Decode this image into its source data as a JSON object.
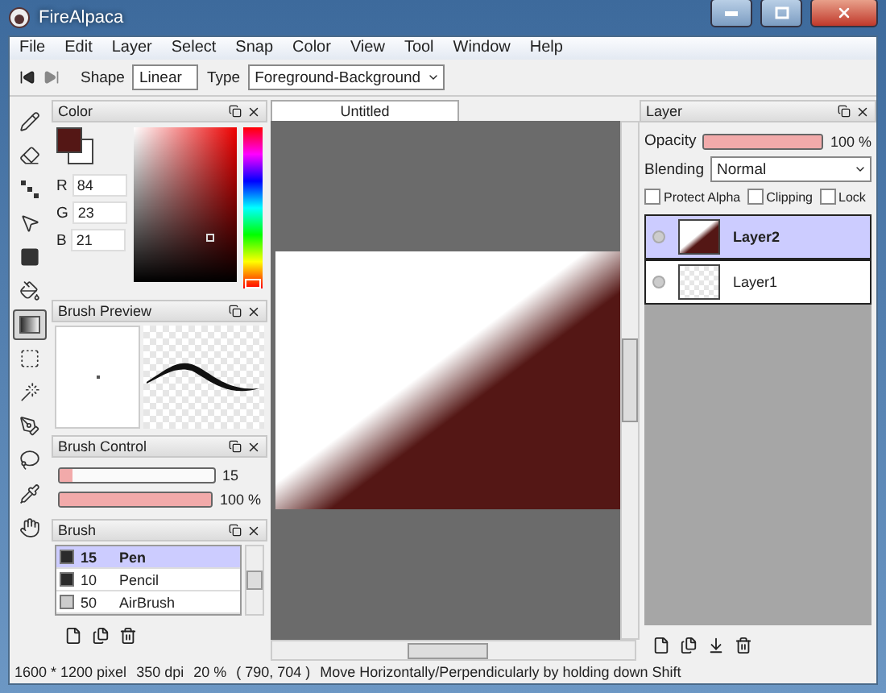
{
  "window": {
    "title": "FireAlpaca"
  },
  "menu": [
    "File",
    "Edit",
    "Layer",
    "Select",
    "Snap",
    "Color",
    "View",
    "Tool",
    "Window",
    "Help"
  ],
  "toolbar": {
    "shape_label": "Shape",
    "shape": "Linear",
    "type_label": "Type",
    "type": "Foreground-Background"
  },
  "tools": [
    {
      "kind": "pencil",
      "selected": false
    },
    {
      "kind": "eraser",
      "selected": false
    },
    {
      "kind": "dots",
      "selected": false
    },
    {
      "kind": "pointer",
      "selected": false
    },
    {
      "kind": "square",
      "selected": false
    },
    {
      "kind": "bucket",
      "selected": false
    },
    {
      "kind": "gradient",
      "selected": true
    },
    {
      "kind": "dashed",
      "selected": false
    },
    {
      "kind": "wand",
      "selected": false
    },
    {
      "kind": "pen",
      "selected": false
    },
    {
      "kind": "lasso",
      "selected": false
    },
    {
      "kind": "pipette",
      "selected": false
    },
    {
      "kind": "hand",
      "selected": false
    }
  ],
  "color_panel": {
    "title": "Color",
    "hue_slider": {
      "level": 0
    },
    "channels": [
      {
        "label": "R",
        "value": "84"
      },
      {
        "label": "G",
        "value": "23"
      },
      {
        "label": "B",
        "value": "21"
      }
    ]
  },
  "brush_preview": {
    "title": "Brush Preview"
  },
  "brush_control": {
    "title": "Brush Control",
    "sliders": [
      {
        "level": 0.08,
        "reading": "15"
      },
      {
        "level": 1,
        "reading": "100 %"
      }
    ]
  },
  "brush_panel": {
    "title": "Brush",
    "items": [
      {
        "size": "15",
        "name": "Pen",
        "selected": true,
        "color": "#2b2b2b"
      },
      {
        "size": "10",
        "name": "Pencil",
        "selected": false,
        "color": "#2b2b2b"
      },
      {
        "size": "50",
        "name": "AirBrush",
        "selected": false,
        "color": "#cccccc"
      }
    ]
  },
  "document": {
    "tab": "Untitled"
  },
  "layer_panel": {
    "title": "Layer",
    "opacity_label": "Opacity",
    "opacity": {
      "level": 1,
      "reading": "100 %"
    },
    "blending_label": "Blending",
    "blending": "Normal",
    "options": [
      {
        "label": "Protect Alpha",
        "checked": false
      },
      {
        "label": "Clipping",
        "checked": false
      },
      {
        "label": "Lock",
        "checked": false
      }
    ],
    "layers": [
      {
        "name": "Layer2",
        "selected": true,
        "kind": "gradient"
      },
      {
        "name": "Layer1",
        "selected": false,
        "kind": "empty"
      }
    ]
  },
  "status_bar": {
    "size": "1600 * 1200 pixel",
    "dpi": "350 dpi",
    "zoom": "20 %",
    "position": "( 790, 704 )",
    "message": "Move Horizontally/Perpendicularly by holding down Shift"
  }
}
